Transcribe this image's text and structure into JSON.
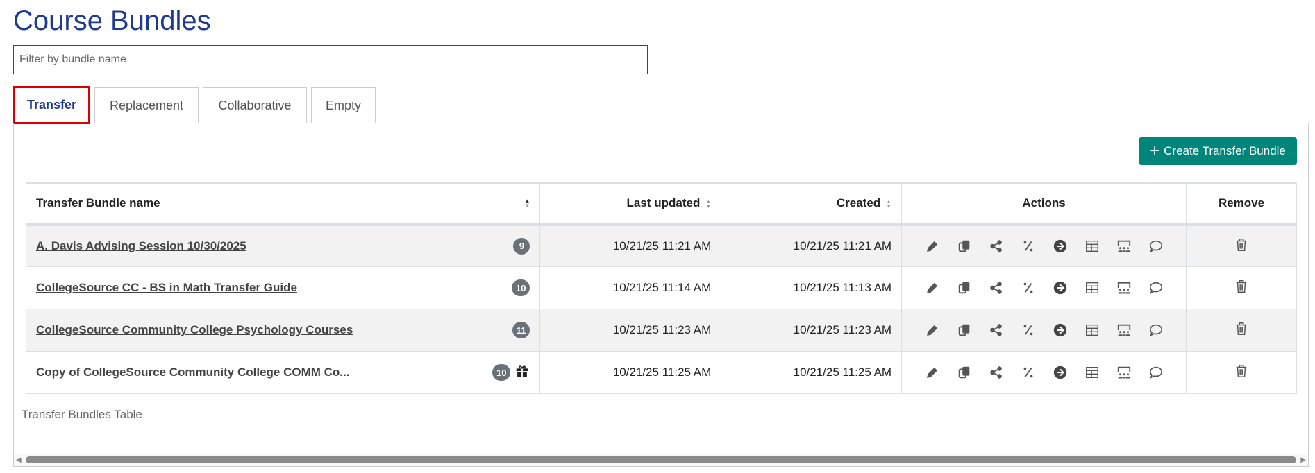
{
  "title": "Course Bundles",
  "filter": {
    "placeholder": "Filter by bundle name",
    "value": ""
  },
  "tabs": [
    {
      "label": "Transfer",
      "active": true
    },
    {
      "label": "Replacement"
    },
    {
      "label": "Collaborative"
    },
    {
      "label": "Empty"
    }
  ],
  "create_button": {
    "icon": "plus-icon",
    "label": "Create Transfer Bundle"
  },
  "colors": {
    "accent": "#00857a",
    "title": "#1f3a8f",
    "active_tab_outline": "#d90000"
  },
  "table": {
    "headers": {
      "name": "Transfer Bundle name",
      "updated": "Last updated",
      "created": "Created",
      "actions": "Actions",
      "remove": "Remove"
    },
    "rows": [
      {
        "name": "A. Davis Advising Session 10/30/2025",
        "count": "9",
        "updated": "10/21/25 11:21 AM",
        "created": "10/21/25 11:21 AM",
        "gift": false
      },
      {
        "name": "CollegeSource CC - BS in Math Transfer Guide",
        "count": "10",
        "updated": "10/21/25 11:14 AM",
        "created": "10/21/25 11:13 AM",
        "gift": false
      },
      {
        "name": "CollegeSource Community College Psychology Courses",
        "count": "11",
        "updated": "10/21/25 11:23 AM",
        "created": "10/21/25 11:23 AM",
        "gift": false
      },
      {
        "name": "Copy of CollegeSource Community College COMM Co...",
        "count": "10",
        "updated": "10/21/25 11:25 AM",
        "created": "10/21/25 11:25 AM",
        "gift": true
      }
    ],
    "action_icons": [
      "pencil-icon",
      "copy-icon",
      "share-icon",
      "percent-icon",
      "arrow-circle-icon",
      "table-icon",
      "audience-icon",
      "comment-icon"
    ],
    "remove_icon": "trash-icon",
    "caption": "Transfer Bundles Table"
  }
}
